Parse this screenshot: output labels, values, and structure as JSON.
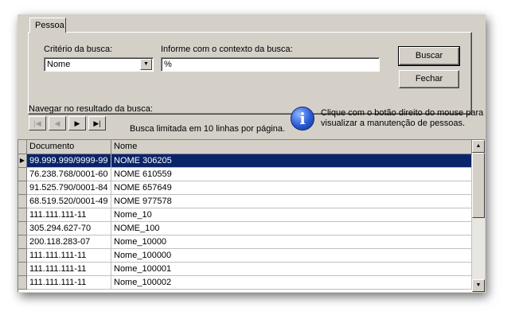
{
  "tab": {
    "label": "Pessoa"
  },
  "search": {
    "criteria_label": "Critério da busca:",
    "criteria_value": "Nome",
    "context_label": "Informe com o contexto da busca:",
    "context_value": "%"
  },
  "buttons": {
    "buscar": "Buscar",
    "fechar": "Fechar"
  },
  "navigation": {
    "label": "Navegar no resultado da busca:",
    "first": "|◀",
    "prev": "◀",
    "next": "▶",
    "last": "▶|",
    "limit_text": "Busca limitada em 10 linhas por página."
  },
  "info": {
    "glyph": "i",
    "line1": "Clique com o botão direito do mouse para",
    "line2": "visualizar a manutenção de pessoas."
  },
  "grid": {
    "columns": [
      "Documento",
      "Nome"
    ],
    "rows": [
      {
        "doc": "99.999.999/9999-99",
        "nome": "NOME 306205",
        "selected": true
      },
      {
        "doc": "76.238.768/0001-60",
        "nome": "NOME 610559"
      },
      {
        "doc": "91.525.790/0001-84",
        "nome": "NOME 657649"
      },
      {
        "doc": "68.519.520/0001-49",
        "nome": "NOME 977578"
      },
      {
        "doc": "111.111.111-11",
        "nome": "Nome_10"
      },
      {
        "doc": "305.294.627-70",
        "nome": "NOME_100"
      },
      {
        "doc": "200.118.283-07",
        "nome": "Nome_10000"
      },
      {
        "doc": "111.111.111-11",
        "nome": "Nome_100000"
      },
      {
        "doc": "111.111.111-11",
        "nome": "Nome_100001"
      },
      {
        "doc": "111.111.111-11",
        "nome": "Nome_100002"
      }
    ],
    "row_indicator": "▶",
    "scroll_up": "▲",
    "scroll_down": "▼"
  },
  "colors": {
    "selection": "#0a246a",
    "face": "#d4d0c8"
  }
}
